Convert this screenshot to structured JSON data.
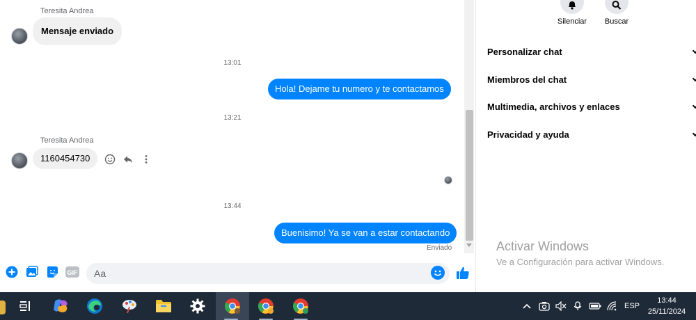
{
  "chat": {
    "messages": {
      "first_sender": "Teresita Andrea",
      "first_text": "Mensaje enviado",
      "time1": "13:01",
      "out1": "Hola! Dejame tu numero y te contactamos",
      "time2": "13:21",
      "second_sender": "Teresita Andrea",
      "second_text": "1160454730",
      "time3": "13:44",
      "out2": "Buenisimo! Ya se van a estar contactando",
      "status": "Enviado"
    },
    "composer": {
      "placeholder": "Aa",
      "gif_label": "GIF"
    },
    "colors": {
      "accent": "#0084ff",
      "incoming_bubble": "#f0f0f0"
    }
  },
  "panel": {
    "actions": [
      {
        "label": "Silenciar",
        "icon": "bell-icon"
      },
      {
        "label": "Buscar",
        "icon": "search-icon"
      }
    ],
    "items": [
      {
        "label": "Personalizar chat"
      },
      {
        "label": "Miembros del chat"
      },
      {
        "label": "Multimedia, archivos y enlaces"
      },
      {
        "label": "Privacidad y ayuda"
      }
    ],
    "watermark_title": "Activar Windows",
    "watermark_sub": "Ve a Configuración para activar Windows."
  },
  "taskbar": {
    "language": "ESP",
    "time": "13:44",
    "date": "25/11/2024"
  }
}
